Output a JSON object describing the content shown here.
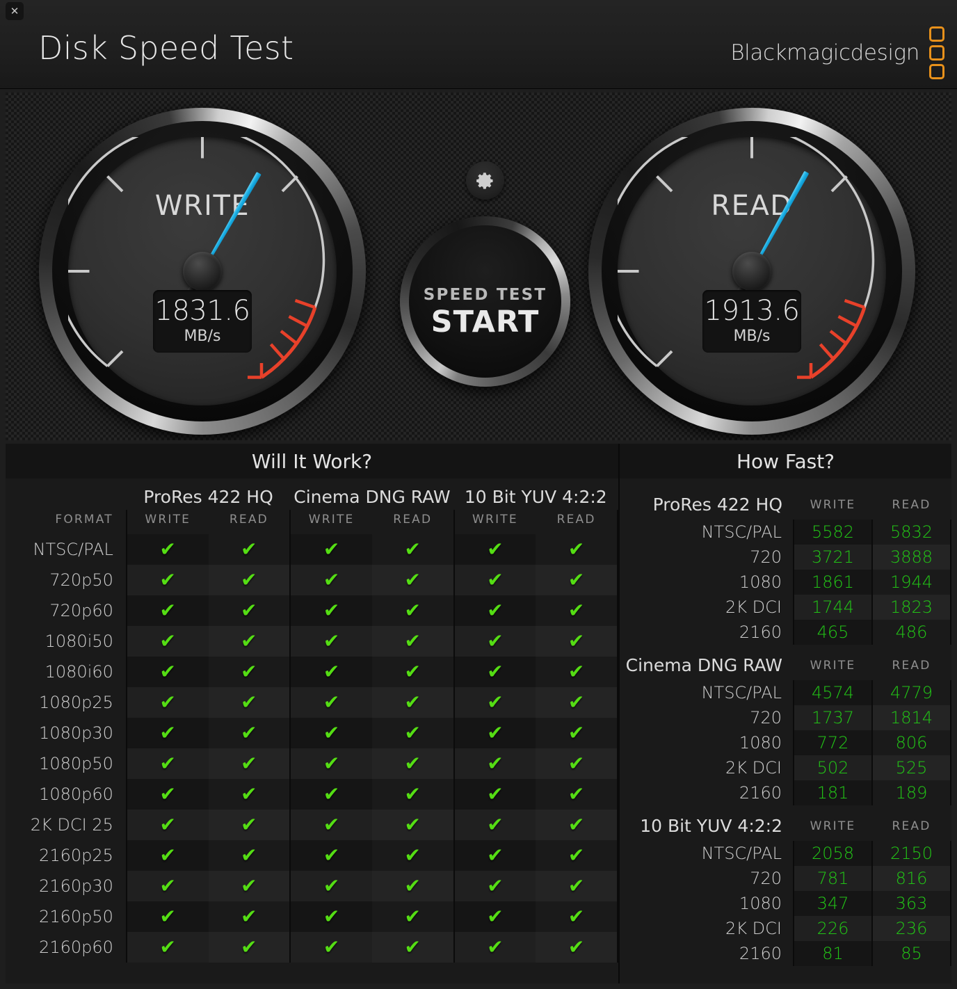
{
  "window": {
    "title": "Disk Speed Test",
    "close_label": "✕",
    "brand": "Blackmagicdesign"
  },
  "gauges": {
    "write": {
      "label": "WRITE",
      "value": "1831.6",
      "unit": "MB/s",
      "needle_angle_deg": 300
    },
    "read": {
      "label": "READ",
      "value": "1913.6",
      "unit": "MB/s",
      "needle_angle_deg": 299
    },
    "accent_needle_color": "#18aee4",
    "redzone_color": "#e8412a",
    "arc_color": "#c9c9c9"
  },
  "controls": {
    "gear_icon": "gear-icon",
    "start_sub_label": "SPEED TEST",
    "start_main_label": "START"
  },
  "will_it_work": {
    "title": "Will It Work?",
    "format_header": "FORMAT",
    "groups": [
      "ProRes 422 HQ",
      "Cinema DNG RAW",
      "10 Bit YUV 4:2:2"
    ],
    "sub_headers": [
      "WRITE",
      "READ"
    ],
    "check_glyph": "✔",
    "check_color": "#55dd14",
    "rows": [
      {
        "format": "NTSC/PAL",
        "cells": [
          true,
          true,
          true,
          true,
          true,
          true
        ]
      },
      {
        "format": "720p50",
        "cells": [
          true,
          true,
          true,
          true,
          true,
          true
        ]
      },
      {
        "format": "720p60",
        "cells": [
          true,
          true,
          true,
          true,
          true,
          true
        ]
      },
      {
        "format": "1080i50",
        "cells": [
          true,
          true,
          true,
          true,
          true,
          true
        ]
      },
      {
        "format": "1080i60",
        "cells": [
          true,
          true,
          true,
          true,
          true,
          true
        ]
      },
      {
        "format": "1080p25",
        "cells": [
          true,
          true,
          true,
          true,
          true,
          true
        ]
      },
      {
        "format": "1080p30",
        "cells": [
          true,
          true,
          true,
          true,
          true,
          true
        ]
      },
      {
        "format": "1080p50",
        "cells": [
          true,
          true,
          true,
          true,
          true,
          true
        ]
      },
      {
        "format": "1080p60",
        "cells": [
          true,
          true,
          true,
          true,
          true,
          true
        ]
      },
      {
        "format": "2K DCI 25",
        "cells": [
          true,
          true,
          true,
          true,
          true,
          true
        ]
      },
      {
        "format": "2160p25",
        "cells": [
          true,
          true,
          true,
          true,
          true,
          true
        ]
      },
      {
        "format": "2160p30",
        "cells": [
          true,
          true,
          true,
          true,
          true,
          true
        ]
      },
      {
        "format": "2160p50",
        "cells": [
          true,
          true,
          true,
          true,
          true,
          true
        ]
      },
      {
        "format": "2160p60",
        "cells": [
          true,
          true,
          true,
          true,
          true,
          true
        ]
      }
    ]
  },
  "how_fast": {
    "title": "How Fast?",
    "sub_headers": [
      "WRITE",
      "READ"
    ],
    "value_color": "#22c416",
    "sections": [
      {
        "name": "ProRes 422 HQ",
        "rows": [
          {
            "label": "NTSC/PAL",
            "write": "5582",
            "read": "5832"
          },
          {
            "label": "720",
            "write": "3721",
            "read": "3888"
          },
          {
            "label": "1080",
            "write": "1861",
            "read": "1944"
          },
          {
            "label": "2K DCI",
            "write": "1744",
            "read": "1823"
          },
          {
            "label": "2160",
            "write": "465",
            "read": "486"
          }
        ]
      },
      {
        "name": "Cinema DNG RAW",
        "rows": [
          {
            "label": "NTSC/PAL",
            "write": "4574",
            "read": "4779"
          },
          {
            "label": "720",
            "write": "1737",
            "read": "1814"
          },
          {
            "label": "1080",
            "write": "772",
            "read": "806"
          },
          {
            "label": "2K DCI",
            "write": "502",
            "read": "525"
          },
          {
            "label": "2160",
            "write": "181",
            "read": "189"
          }
        ]
      },
      {
        "name": "10 Bit YUV 4:2:2",
        "rows": [
          {
            "label": "NTSC/PAL",
            "write": "2058",
            "read": "2150"
          },
          {
            "label": "720",
            "write": "781",
            "read": "816"
          },
          {
            "label": "1080",
            "write": "347",
            "read": "363"
          },
          {
            "label": "2K DCI",
            "write": "226",
            "read": "236"
          },
          {
            "label": "2160",
            "write": "81",
            "read": "85"
          }
        ]
      }
    ]
  }
}
